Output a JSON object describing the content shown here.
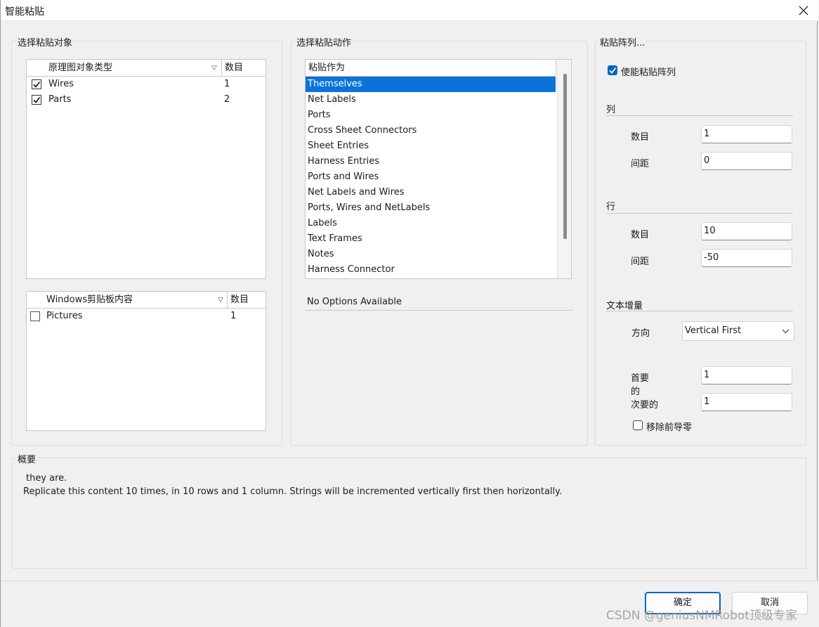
{
  "window": {
    "title": "智能粘贴"
  },
  "select_objects": {
    "label": "选择粘贴对象",
    "schematic_table": {
      "col_type": "原理图对象类型",
      "col_count": "数目",
      "rows": [
        {
          "name": "Wires",
          "count": "1",
          "checked": true
        },
        {
          "name": "Parts",
          "count": "2",
          "checked": true
        }
      ]
    },
    "clipboard_table": {
      "col_type": "Windows剪贴板内容",
      "col_count": "数目",
      "rows": [
        {
          "name": "Pictures",
          "count": "1",
          "checked": false
        }
      ]
    }
  },
  "paste_action": {
    "label": "选择粘贴动作",
    "list_header": "粘贴作为",
    "items": [
      "Themselves",
      "Net Labels",
      "Ports",
      "Cross Sheet Connectors",
      "Sheet Entries",
      "Harness Entries",
      "Ports and Wires",
      "Net Labels and Wires",
      "Ports, Wires and NetLabels",
      "Labels",
      "Text Frames",
      "Notes",
      "Harness Connector"
    ],
    "selected": "Themselves",
    "options_text": "No Options Available"
  },
  "paste_array": {
    "label": "粘贴阵列...",
    "enable_label": "使能粘贴阵列",
    "enable_checked": true,
    "columns": {
      "label": "列",
      "count_label": "数目",
      "count_value": "1",
      "spacing_label": "间距",
      "spacing_value": "0"
    },
    "rows": {
      "label": "行",
      "count_label": "数目",
      "count_value": "10",
      "spacing_label": "间距",
      "spacing_value": "-50"
    },
    "text_increment": {
      "label": "文本增量",
      "direction_label": "方向",
      "direction_value": "Vertical First",
      "primary_label_1": "首要",
      "primary_label_2": "的",
      "primary_value": "1",
      "secondary_label": "次要的",
      "secondary_value": "1",
      "remove_zeros_label": "移除前导零",
      "remove_zeros_checked": false
    }
  },
  "summary": {
    "label": "概要",
    "line1": "they are.",
    "line2": "Replicate this content 10 times, in 10 rows and 1 column. Strings will be incremented vertically first then horizontally."
  },
  "buttons": {
    "ok": "确定",
    "cancel": "取消"
  },
  "watermark": "CSDN @geniusNMRobot顶级专家",
  "colors": {
    "selection": "#0a72d8",
    "checkbox_accent": "#0067c0"
  }
}
